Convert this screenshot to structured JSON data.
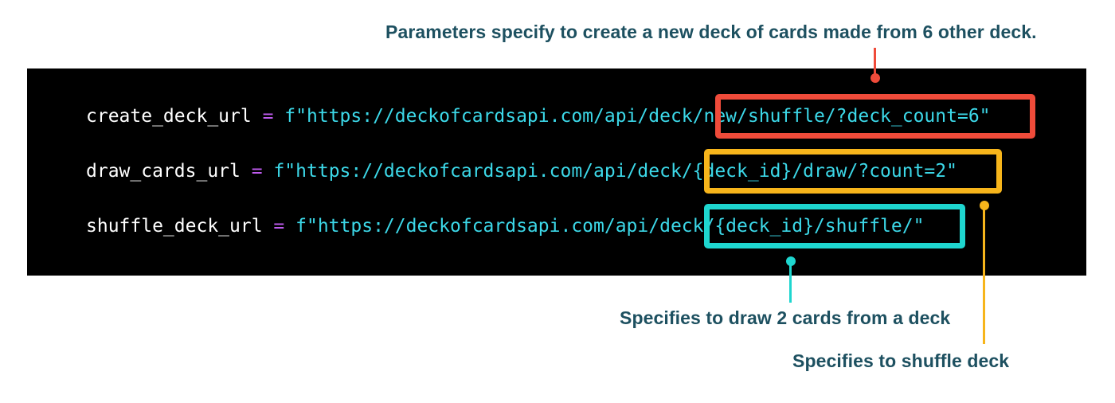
{
  "annotations": {
    "top": "Parameters specify to create a new deck of cards made from 6 other deck.",
    "draw": "Specifies to draw 2 cards from a deck",
    "shuffle": "Specifies to shuffle deck"
  },
  "code": {
    "lines": [
      {
        "var": "create_deck_url",
        "op": "=",
        "str": "f\"https://deckofcardsapi.com/api/deck/new/shuffle/?deck_count=6\""
      },
      {
        "var": "draw_cards_url",
        "op": "=",
        "str": "f\"https://deckofcardsapi.com/api/deck/{deck_id}/draw/?count=2\""
      },
      {
        "var": "shuffle_deck_url",
        "op": "=",
        "str": "f\"https://deckofcardsapi.com/api/deck/{deck_id}/shuffle/\""
      }
    ]
  },
  "colors": {
    "background": "#000000",
    "annotation_text": "#1d5060",
    "string": "#3cd8e8",
    "operator": "#c05cf0",
    "highlight_red": "#ef4b3a",
    "highlight_yellow": "#f7b51b",
    "highlight_teal": "#1ed6cf"
  }
}
